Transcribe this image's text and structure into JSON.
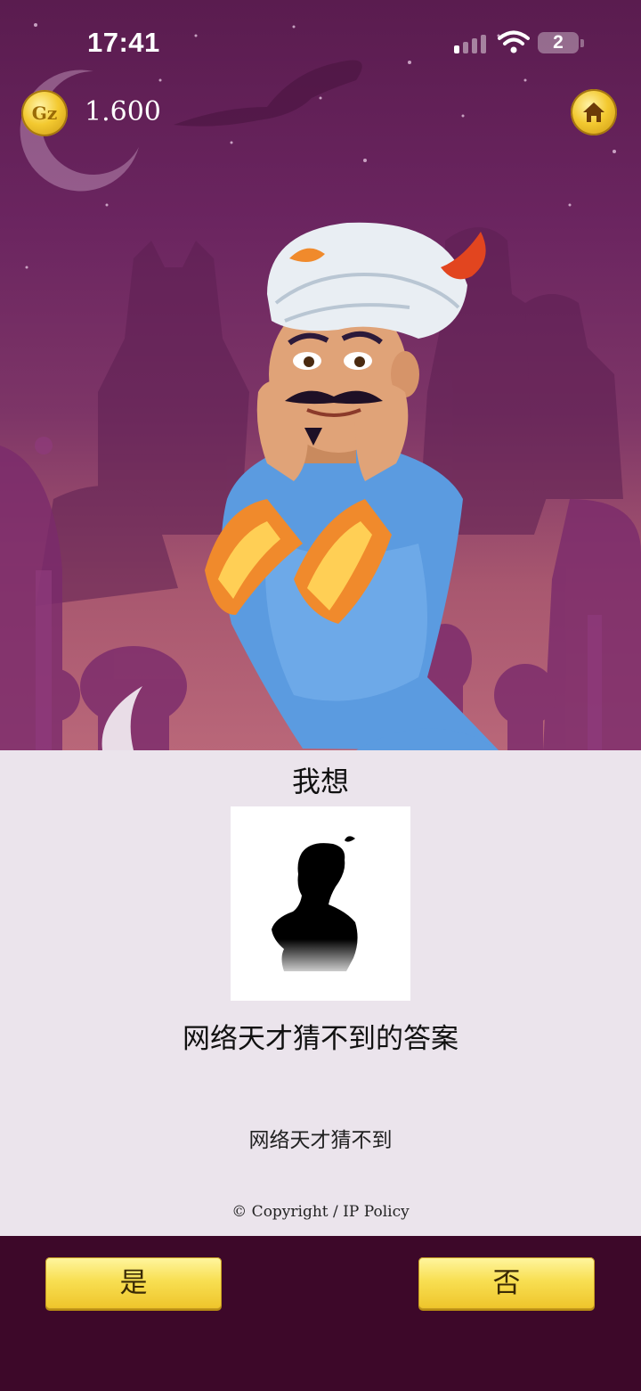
{
  "status_bar": {
    "time": "17:41",
    "battery": "2"
  },
  "header": {
    "coins": "1.600",
    "coin_symbol": "Gz"
  },
  "result": {
    "heading": "我想",
    "name": "网络天才猜不到的答案",
    "description": "网络天才猜不到"
  },
  "footer": {
    "copyright": "© Copyright / IP Policy",
    "yes_label": "是",
    "no_label": "否"
  },
  "icons": [
    "signal-icon",
    "wifi-icon",
    "battery-icon",
    "coin-icon",
    "home-icon",
    "silhouette-icon"
  ],
  "colors": {
    "background_top": "#5a1c4f",
    "panel": "#ebe4ec",
    "footer": "#3d0829",
    "button_gold": "#f8df52"
  }
}
